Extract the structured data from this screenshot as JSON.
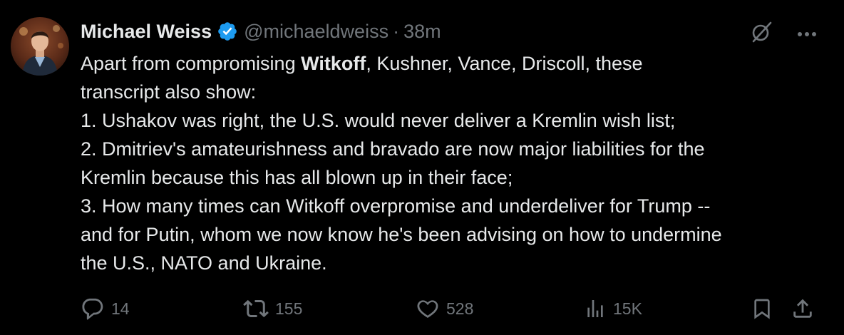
{
  "author": {
    "name": "Michael Weiss",
    "handle": "@michaeldweiss",
    "separator": "·",
    "time": "38m"
  },
  "icons": {
    "verified": "verified-badge-icon",
    "grok": "grok-icon",
    "more": "more-icon",
    "reply": "reply-icon",
    "repost": "repost-icon",
    "like": "like-icon",
    "views": "views-icon",
    "bookmark": "bookmark-icon",
    "share": "share-icon"
  },
  "body": {
    "line1_pre": "Apart from compromising ",
    "line1_bold": "Witkoff",
    "line1_post": ", Kushner, Vance, Driscoll, these",
    "line2": "transcript also show:",
    "line3": "1. Ushakov was right, the U.S. would never deliver a Kremlin wish list;",
    "line4": "2. Dmitriev's amateurishness and bravado are now major liabilities for the",
    "line5": "Kremlin because this has all blown up in their face;",
    "line6": "3. How many times can Witkoff overpromise and underdeliver for Trump --",
    "line7": "and for Putin, whom we now know he's been advising on how to undermine",
    "line8": "the U.S., NATO and Ukraine."
  },
  "actions": {
    "replies": "14",
    "reposts": "155",
    "likes": "528",
    "views": "15K"
  },
  "colors": {
    "background": "#000000",
    "text": "#e7e9ea",
    "secondary": "#71767b",
    "verified": "#1d9bf0"
  }
}
